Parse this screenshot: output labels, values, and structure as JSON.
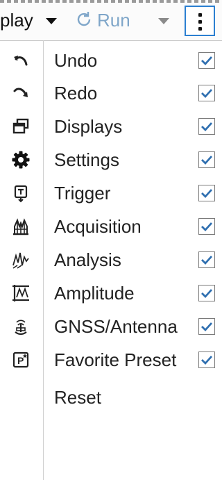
{
  "toolbar": {
    "display_label": "play",
    "run_label": "Run"
  },
  "menu": {
    "items": [
      {
        "label": "Undo",
        "icon": "undo-icon",
        "checked": true
      },
      {
        "label": "Redo",
        "icon": "redo-icon",
        "checked": true
      },
      {
        "label": "Displays",
        "icon": "displays-icon",
        "checked": true
      },
      {
        "label": "Settings",
        "icon": "gear-icon",
        "checked": true
      },
      {
        "label": "Trigger",
        "icon": "trigger-icon",
        "checked": true
      },
      {
        "label": "Acquisition",
        "icon": "acquisition-icon",
        "checked": true
      },
      {
        "label": "Analysis",
        "icon": "analysis-icon",
        "checked": true
      },
      {
        "label": "Amplitude",
        "icon": "amplitude-icon",
        "checked": true
      },
      {
        "label": "GNSS/Antenna",
        "icon": "antenna-icon",
        "checked": true
      },
      {
        "label": "Favorite Preset",
        "icon": "preset-icon",
        "checked": true
      }
    ],
    "reset_label": "Reset"
  },
  "colors": {
    "accent": "#2b7fd1",
    "check": "#2f6fb0",
    "run_text": "#7fa6c9"
  }
}
